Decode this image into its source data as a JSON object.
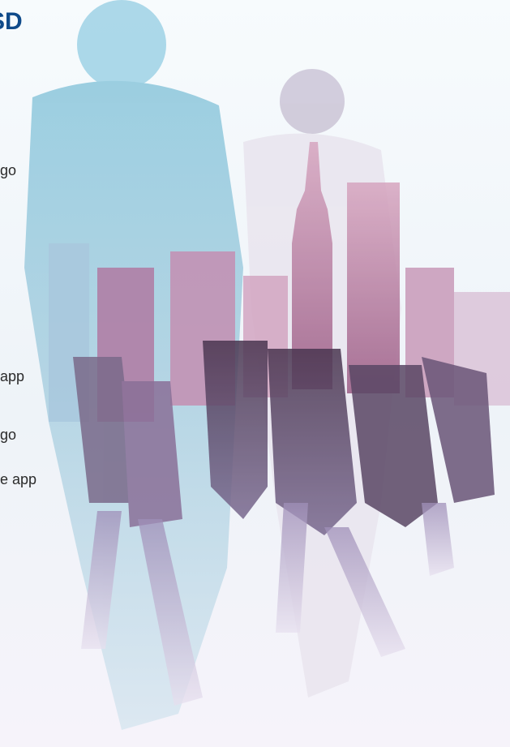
{
  "heading": "SD",
  "text_fragments": [
    "go",
    "app",
    "go",
    "e app"
  ],
  "colors": {
    "heading": "#0f4a8a",
    "body_text": "#2a2a2a",
    "overlay_blue": "#9fd3e6",
    "overlay_purple": "#9b6a9e"
  },
  "image": {
    "name": "business-people-walking-city-skyline-double-exposure"
  }
}
